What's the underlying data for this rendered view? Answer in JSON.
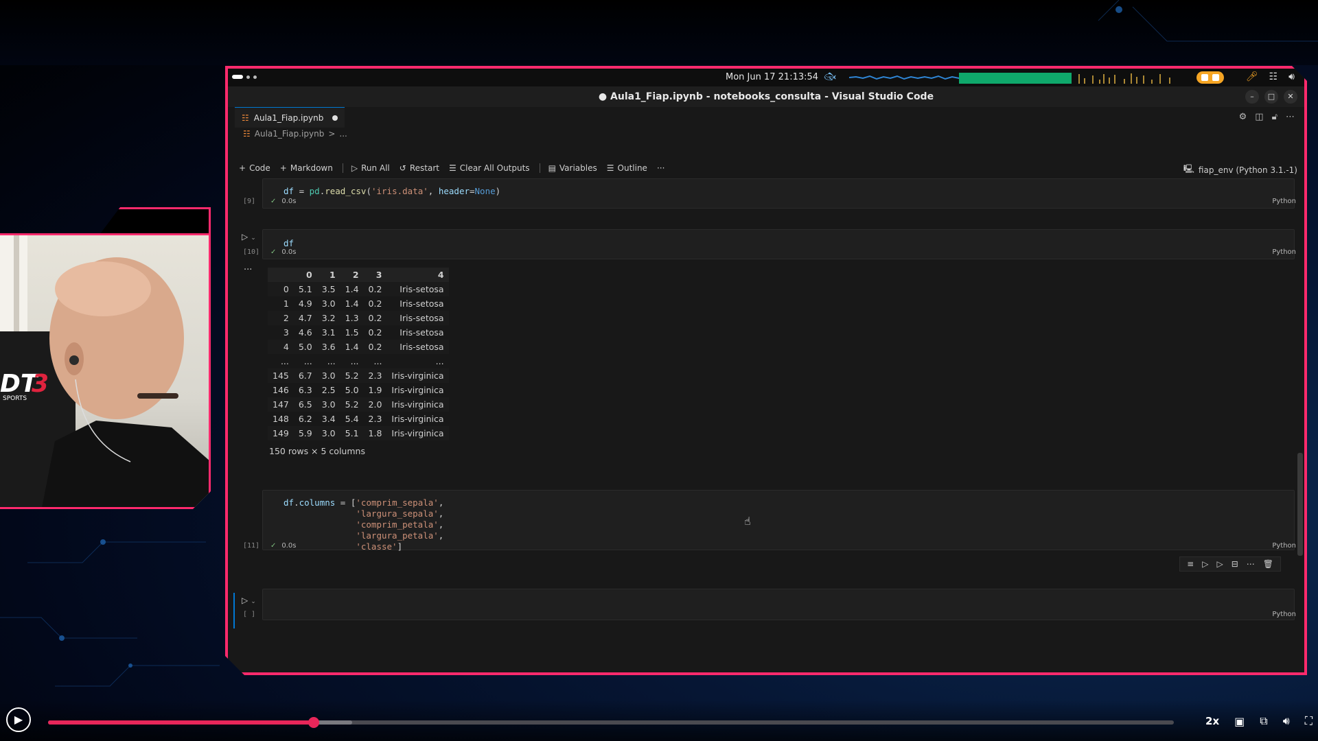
{
  "system_bar": {
    "clock": "Mon Jun 17  21:13:54",
    "icons": [
      "mic-icon",
      "network-icon",
      "volume-icon"
    ]
  },
  "window": {
    "title": "Aula1_Fiap.ipynb - notebooks_consulta - Visual Studio Code",
    "controls": [
      "minimize-icon",
      "maximize-icon",
      "close-icon"
    ]
  },
  "tab": {
    "label": "Aula1_Fiap.ipynb"
  },
  "breadcrumb": {
    "file": "Aula1_Fiap.ipynb",
    "separator": ">",
    "more": "..."
  },
  "toolbar": {
    "code": "Code",
    "markdown": "Markdown",
    "run_all": "Run All",
    "restart": "Restart",
    "clear_outputs": "Clear All Outputs",
    "variables": "Variables",
    "outline": "Outline",
    "more": "···",
    "kernel": "fiap_env (Python 3.1.-1)"
  },
  "cells": [
    {
      "exec_count": "[9]",
      "code": "df = pd.read_csv('iris.data', header=None)",
      "duration": "0.0s",
      "language": "Python"
    },
    {
      "exec_count": "[10]",
      "code": "df",
      "duration": "0.0s",
      "language": "Python"
    },
    {
      "exec_count": "[11]",
      "code": "df.columns = ['comprim_sepala',\n              'largura_sepala',\n              'comprim_petala',\n              'largura_petala',\n              'classe']",
      "duration": "0.0s",
      "language": "Python"
    },
    {
      "exec_count": "[ ]",
      "code": "",
      "language": "Python"
    }
  ],
  "dataframe": {
    "columns": [
      "",
      "0",
      "1",
      "2",
      "3",
      "4"
    ],
    "rows": [
      [
        "0",
        "5.1",
        "3.5",
        "1.4",
        "0.2",
        "Iris-setosa"
      ],
      [
        "1",
        "4.9",
        "3.0",
        "1.4",
        "0.2",
        "Iris-setosa"
      ],
      [
        "2",
        "4.7",
        "3.2",
        "1.3",
        "0.2",
        "Iris-setosa"
      ],
      [
        "3",
        "4.6",
        "3.1",
        "1.5",
        "0.2",
        "Iris-setosa"
      ],
      [
        "4",
        "5.0",
        "3.6",
        "1.4",
        "0.2",
        "Iris-setosa"
      ],
      [
        "...",
        "...",
        "...",
        "...",
        "...",
        "..."
      ],
      [
        "145",
        "6.7",
        "3.0",
        "5.2",
        "2.3",
        "Iris-virginica"
      ],
      [
        "146",
        "6.3",
        "2.5",
        "5.0",
        "1.9",
        "Iris-virginica"
      ],
      [
        "147",
        "6.5",
        "3.0",
        "5.2",
        "2.0",
        "Iris-virginica"
      ],
      [
        "148",
        "6.2",
        "3.4",
        "5.4",
        "2.3",
        "Iris-virginica"
      ],
      [
        "149",
        "5.9",
        "3.0",
        "5.1",
        "1.8",
        "Iris-virginica"
      ]
    ],
    "shape": "150 rows × 5 columns"
  },
  "output_more": "···",
  "video": {
    "speed": "2x",
    "progress_fraction": 0.236,
    "buffered_fraction": 0.27
  },
  "colors": {
    "accent_frame": "#ff2a6d",
    "progress": "#e8265a",
    "vscode_blue": "#0078d4"
  },
  "overlay_logo": "DT3 SPORTS"
}
